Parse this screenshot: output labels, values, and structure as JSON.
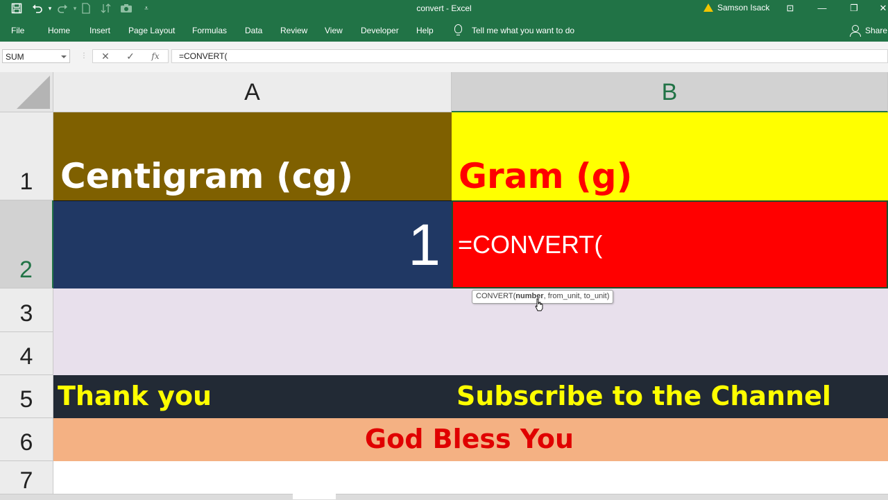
{
  "window": {
    "title": "convert  -  Excel",
    "user": "Samson Isack",
    "controls": [
      "⊡",
      "—",
      "❐",
      "✕"
    ]
  },
  "quick_access": [
    "save-icon",
    "undo-icon",
    "redo-icon",
    "new-icon",
    "sort-icon",
    "camera-icon",
    "customize-icon"
  ],
  "ribbon": {
    "tabs": [
      "File",
      "Home",
      "Insert",
      "Page Layout",
      "Formulas",
      "Data",
      "Review",
      "View",
      "Developer",
      "Help"
    ],
    "tell_me": "Tell me what you want to do",
    "share": "Share"
  },
  "formula_bar": {
    "name_box": "SUM",
    "cancel": "✕",
    "enter": "✓",
    "fx": "fx",
    "formula": "=CONVERT("
  },
  "grid": {
    "columns": [
      "A",
      "B"
    ],
    "rows": [
      "1",
      "2",
      "3",
      "4",
      "5",
      "6",
      "7"
    ],
    "active_column": "B",
    "active_row": "2"
  },
  "cells": {
    "A1": "Centigram (cg)",
    "B1": "Gram (g)",
    "A2": "1",
    "B2": "=CONVERT(",
    "A5": "Thank you",
    "B5": "Subscribe to the Channel",
    "A6": "God Bless You"
  },
  "tooltip": {
    "prefix": "CONVERT(",
    "bold_arg": "number",
    "rest": ", from_unit, to_unit)"
  },
  "colors": {
    "excel_green": "#217346",
    "A1_fill": "#7f6000",
    "B1_fill": "#ffff00",
    "A2_fill": "#203864",
    "B2_fill": "#ff0000",
    "rows34_fill": "#e8e0ec",
    "row5_fill": "#222a35",
    "row6_fill": "#f4b183",
    "yellow_text": "#ffff00",
    "red_text": "#ff0000"
  }
}
